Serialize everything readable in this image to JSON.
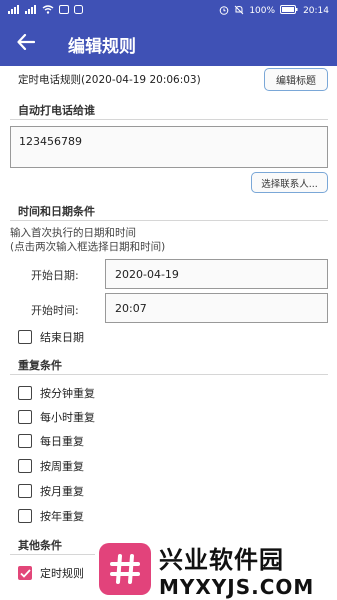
{
  "status_bar": {
    "left_icons": [
      "signal-icon",
      "signal-icon",
      "wifi-icon",
      "message-icon",
      "app-icon"
    ],
    "alarm_icon": "alarm-icon",
    "mute_icon": "mute-icon",
    "battery_percent": "100%",
    "time": "20:14"
  },
  "app_bar": {
    "title": "编辑规则",
    "back_icon": "back-arrow-icon"
  },
  "rule": {
    "name": "定时电话规则(2020-04-19 20:06:03)",
    "edit_title_button": "编辑标题"
  },
  "call_section": {
    "heading": "自动打电话给谁",
    "phone_value": "123456789",
    "select_contact_button": "选择联系人..."
  },
  "time_section": {
    "heading": "时间和日期条件",
    "hint_line1": "输入首次执行的日期和时间",
    "hint_line2": "(点击两次输入框选择日期和时间)",
    "start_date_label": "开始日期:",
    "start_date_value": "2020-04-19",
    "start_time_label": "开始时间:",
    "start_time_value": "20:07",
    "end_date_label": "结束日期",
    "end_date_checked": false
  },
  "repeat_section": {
    "heading": "重复条件",
    "options": [
      {
        "label": "按分钟重复",
        "checked": false
      },
      {
        "label": "每小时重复",
        "checked": false
      },
      {
        "label": "每日重复",
        "checked": false
      },
      {
        "label": "按周重复",
        "checked": false
      },
      {
        "label": "按月重复",
        "checked": false
      },
      {
        "label": "按年重复",
        "checked": false
      }
    ]
  },
  "other_section": {
    "heading": "其他条件",
    "timer_rule_label": "定时规则",
    "timer_rule_checked": true
  },
  "watermark": {
    "text_cn": "兴业软件园",
    "text_en": "MYXYJS.COM"
  },
  "colors": {
    "primary": "#3f51b5",
    "checkbox_checked": "#e24679",
    "button_border": "#7aa7d7"
  }
}
